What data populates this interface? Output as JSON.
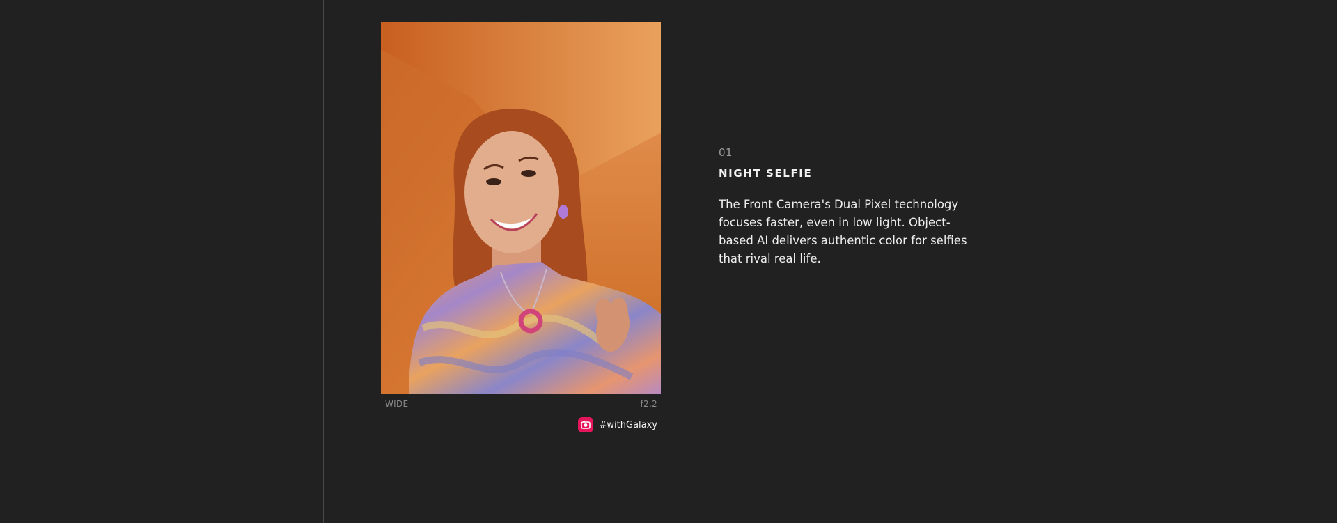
{
  "photo": {
    "lens": "WIDE",
    "aperture": "f2.2",
    "hashtag": "#withGalaxy",
    "hashtag_icon": "instagram-icon",
    "accent_color": "#e6165c"
  },
  "feature": {
    "index": "01",
    "title": "NIGHT SELFIE",
    "description": "The Front Camera's Dual Pixel technology focuses faster, even in low light. Object-based AI delivers authentic color for selfies that rival real life."
  }
}
